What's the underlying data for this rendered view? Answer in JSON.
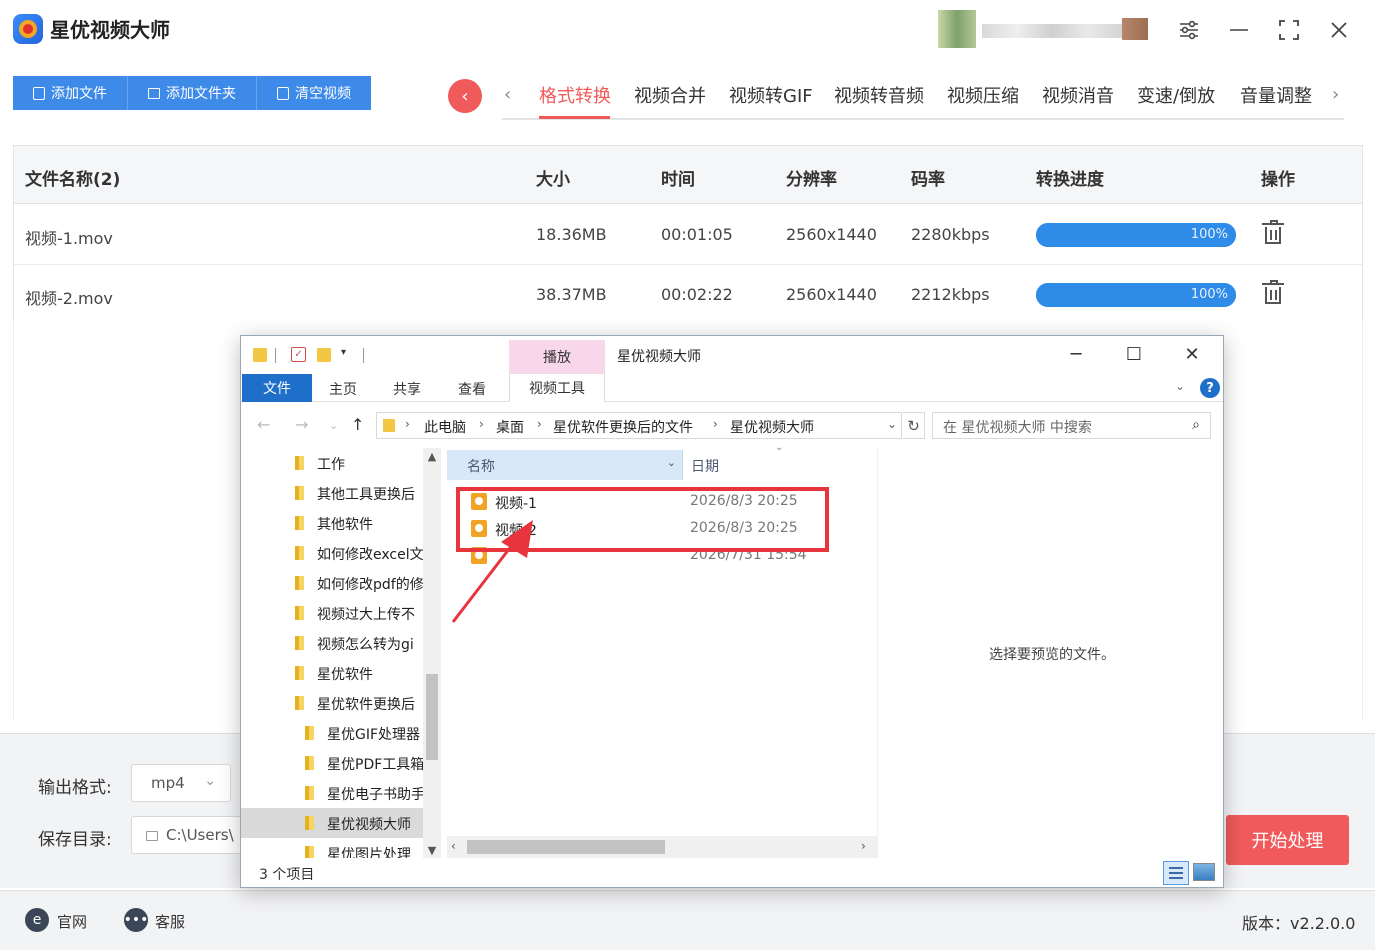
{
  "app": {
    "title": "星优视频大师",
    "version": "版本：v2.2.0.0"
  },
  "toolbar": {
    "add_file": "添加文件",
    "add_folder": "添加文件夹",
    "clear": "清空视频"
  },
  "tabs": [
    "格式转换",
    "视频合并",
    "视频转GIF",
    "视频转音频",
    "视频压缩",
    "视频消音",
    "变速/倒放",
    "音量调整"
  ],
  "active_tab": "格式转换",
  "table": {
    "headers": {
      "name": "文件名称(2)",
      "size": "大小",
      "time": "时间",
      "resolution": "分辨率",
      "bitrate": "码率",
      "progress": "转换进度",
      "action": "操作"
    },
    "rows": [
      {
        "name": "视频-1.mov",
        "size": "18.36MB",
        "time": "00:01:05",
        "resolution": "2560x1440",
        "bitrate": "2280kbps",
        "progress_text": "100%",
        "progress": 100
      },
      {
        "name": "视频-2.mov",
        "size": "38.37MB",
        "time": "00:02:22",
        "resolution": "2560x1440",
        "bitrate": "2212kbps",
        "progress_text": "100%",
        "progress": 100
      }
    ]
  },
  "output": {
    "format_label": "输出格式:",
    "format_value": "mp4",
    "dir_label": "保存目录:",
    "dir_value": "C:\\Users\\",
    "start": "开始处理"
  },
  "status": {
    "website": "官网",
    "support": "客服"
  },
  "explorer": {
    "title": "星优视频大师",
    "context_tab": "播放",
    "ribbon": {
      "file": "文件",
      "home": "主页",
      "share": "共享",
      "view": "查看",
      "video_tools": "视频工具"
    },
    "breadcrumb": [
      "此电脑",
      "桌面",
      "星优软件更换后的文件",
      "星优视频大师"
    ],
    "search_placeholder": "在 星优视频大师 中搜索",
    "tree": [
      {
        "label": "工作",
        "indent": 0,
        "selected": false
      },
      {
        "label": "其他工具更换后",
        "indent": 0,
        "selected": false
      },
      {
        "label": "其他软件",
        "indent": 0,
        "selected": false
      },
      {
        "label": "如何修改excel文",
        "indent": 0,
        "selected": false
      },
      {
        "label": "如何修改pdf的修",
        "indent": 0,
        "selected": false
      },
      {
        "label": "视频过大上传不",
        "indent": 0,
        "selected": false
      },
      {
        "label": "视频怎么转为gi",
        "indent": 0,
        "selected": false
      },
      {
        "label": "星优软件",
        "indent": 0,
        "selected": false
      },
      {
        "label": "星优软件更换后",
        "indent": 0,
        "selected": false
      },
      {
        "label": "星优GIF处理器",
        "indent": 1,
        "selected": false
      },
      {
        "label": "星优PDF工具箱",
        "indent": 1,
        "selected": false
      },
      {
        "label": "星优电子书助手",
        "indent": 1,
        "selected": false
      },
      {
        "label": "星优视频大师",
        "indent": 1,
        "selected": true
      },
      {
        "label": "星优图片处理",
        "indent": 1,
        "selected": false
      }
    ],
    "columns": {
      "name": "名称",
      "date": "日期"
    },
    "files": [
      {
        "name": "视频-1",
        "date": "2026/8/3 20:25"
      },
      {
        "name": "视频-2",
        "date": "2026/8/3 20:25"
      },
      {
        "name": "",
        "date": "2026/7/31 15:54"
      }
    ],
    "preview_text": "选择要预览的文件。",
    "item_count": "3 个项目"
  }
}
